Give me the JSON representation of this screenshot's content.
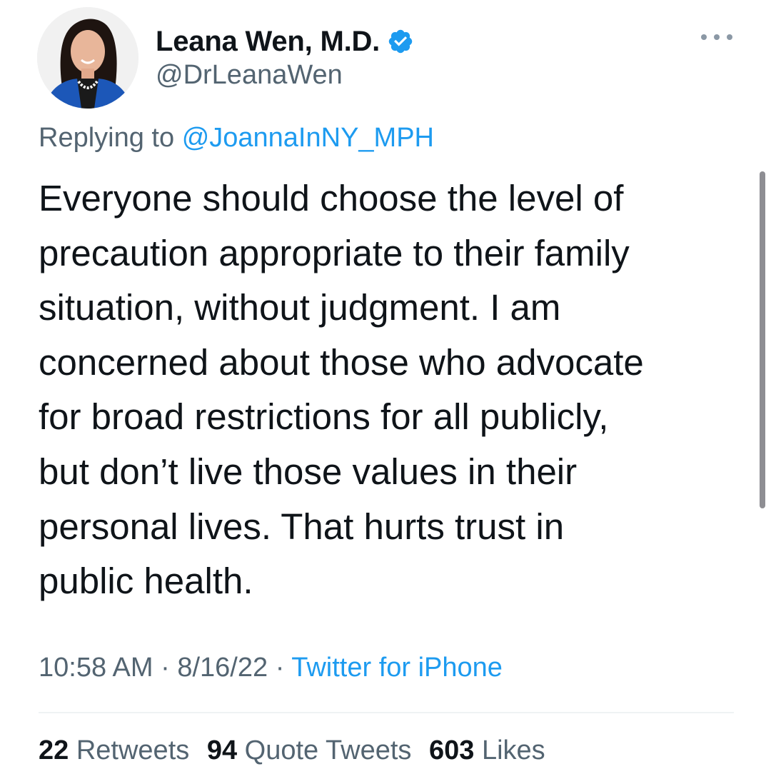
{
  "author": {
    "display_name": "Leana Wen, M.D.",
    "handle": "@DrLeanaWen",
    "verified": true,
    "avatar_icon": "profile-photo"
  },
  "reply": {
    "prefix": "Replying to",
    "mention": "@JoannaInNY_MPH"
  },
  "tweet": {
    "lines": [
      "Everyone should choose the level of",
      "precaution appropriate to their family",
      "situation, without judgment. I am",
      "concerned about those who advocate",
      "for broad restrictions for all publicly,",
      "but don’t live those values in their",
      "personal lives. That hurts trust in",
      "public health."
    ]
  },
  "meta": {
    "time": "10:58 AM",
    "separator": "·",
    "date": "8/16/22",
    "source": "Twitter for iPhone"
  },
  "stats": {
    "retweets": {
      "count": "22",
      "label": "Retweets"
    },
    "quote_tweets": {
      "count": "94",
      "label": "Quote Tweets"
    },
    "likes": {
      "count": "603",
      "label": "Likes"
    }
  },
  "colors": {
    "text": "#0f1419",
    "secondary": "#536471",
    "accent": "#1d9bf0",
    "verified": "#1d9bf0"
  },
  "icons": {
    "verified": "verified-badge-icon",
    "more": "more-options-icon"
  }
}
